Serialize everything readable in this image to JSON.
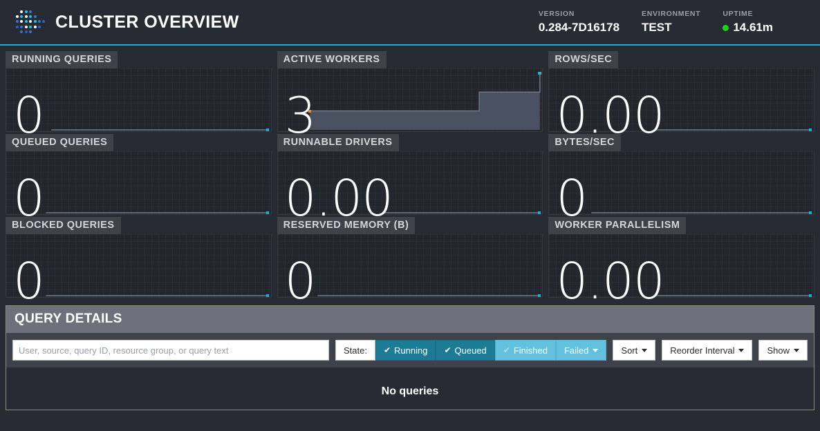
{
  "header": {
    "title": "CLUSTER OVERVIEW",
    "logo_icon": "trino-dots-logo-icon",
    "stats": [
      {
        "label": "VERSION",
        "value": "0.284-7D16178"
      },
      {
        "label": "ENVIRONMENT",
        "value": "TEST"
      },
      {
        "label": "UPTIME",
        "value": "14.61m",
        "dot_color": "#19d219"
      }
    ],
    "accent_color": "#19b0d6"
  },
  "stat_cards": [
    {
      "label": "RUNNING QUERIES",
      "value": "0",
      "chart_data": {
        "type": "area",
        "title": "Running Queries",
        "points": [
          0,
          0,
          0,
          0,
          0,
          0,
          0,
          0,
          0,
          0,
          0,
          0,
          0,
          0,
          0,
          0,
          0,
          0,
          0,
          0
        ],
        "ylim": [
          0,
          1
        ],
        "line_color": "#5c6775",
        "fill_color": "#4a5261",
        "endpoint_color": "#19b0d6",
        "grid": true,
        "spark_left_pct": 17,
        "has_start_marker": false
      }
    },
    {
      "label": "ACTIVE WORKERS",
      "value": "3",
      "chart_data": {
        "type": "area",
        "title": "Active Workers",
        "points": [
          1,
          1,
          1,
          1,
          1,
          1,
          1,
          1,
          1,
          1,
          1,
          1,
          1,
          1,
          2,
          2,
          2,
          2,
          2,
          3
        ],
        "ylim": [
          0,
          3
        ],
        "line_color": "#6b7481",
        "fill_color": "#49505f",
        "endpoint_color": "#19b0d6",
        "marker_color": "#f08a24",
        "grid": true,
        "spark_left_pct": 12,
        "has_start_marker": true
      }
    },
    {
      "label": "ROWS/SEC",
      "value": "0.00",
      "chart_data": {
        "type": "area",
        "title": "Rows per Second",
        "points": [
          0,
          0,
          0,
          0,
          0,
          0,
          0,
          0,
          0,
          0,
          0,
          0,
          0,
          0,
          0,
          0,
          0,
          0,
          0,
          0
        ],
        "ylim": [
          0,
          1
        ],
        "line_color": "#5c6775",
        "fill_color": "#4a5261",
        "endpoint_color": "#19b0d6",
        "grid": true,
        "spark_left_pct": 40,
        "has_start_marker": false
      }
    },
    {
      "label": "QUEUED QUERIES",
      "value": "0",
      "chart_data": {
        "type": "area",
        "title": "Queued Queries",
        "points": [
          0,
          0,
          0,
          0,
          0,
          0,
          0,
          0,
          0,
          0,
          0,
          0,
          0,
          0,
          0,
          0,
          0,
          0,
          0,
          0
        ],
        "ylim": [
          0,
          1
        ],
        "line_color": "#5c6775",
        "fill_color": "#4a5261",
        "endpoint_color": "#19b0d6",
        "grid": true,
        "spark_left_pct": 15,
        "has_start_marker": false
      }
    },
    {
      "label": "RUNNABLE DRIVERS",
      "value": "0.00",
      "chart_data": {
        "type": "area",
        "title": "Runnable Drivers",
        "points": [
          0,
          0,
          0,
          0,
          0,
          0,
          0,
          0,
          0,
          0,
          0,
          0,
          0,
          0,
          0,
          0,
          0,
          0,
          0,
          0
        ],
        "ylim": [
          0,
          1
        ],
        "line_color": "#5c6775",
        "fill_color": "#4a5261",
        "endpoint_color": "#19b0d6",
        "grid": true,
        "spark_left_pct": 40,
        "has_start_marker": false
      }
    },
    {
      "label": "BYTES/SEC",
      "value": "0",
      "chart_data": {
        "type": "area",
        "title": "Bytes per Second",
        "points": [
          0,
          0,
          0,
          0,
          0,
          0,
          0,
          0,
          0,
          0,
          0,
          0,
          0,
          0,
          0,
          0,
          0,
          0,
          0,
          0
        ],
        "ylim": [
          0,
          1
        ],
        "line_color": "#5c6775",
        "fill_color": "#4a5261",
        "endpoint_color": "#19b0d6",
        "grid": true,
        "spark_left_pct": 16,
        "has_start_marker": false
      }
    },
    {
      "label": "BLOCKED QUERIES",
      "value": "0",
      "chart_data": {
        "type": "area",
        "title": "Blocked Queries",
        "points": [
          0,
          0,
          0,
          0,
          0,
          0,
          0,
          0,
          0,
          0,
          0,
          0,
          0,
          0,
          0,
          0,
          0,
          0,
          0,
          0
        ],
        "ylim": [
          0,
          1
        ],
        "line_color": "#5c6775",
        "fill_color": "#4a5261",
        "endpoint_color": "#19b0d6",
        "grid": true,
        "spark_left_pct": 15,
        "has_start_marker": false
      }
    },
    {
      "label": "RESERVED MEMORY (B)",
      "value": "0",
      "chart_data": {
        "type": "area",
        "title": "Reserved Memory (B)",
        "points": [
          0,
          0,
          0,
          0,
          0,
          0,
          0,
          0,
          0,
          0,
          0,
          0,
          0,
          0,
          0,
          0,
          0,
          0,
          0,
          0
        ],
        "ylim": [
          0,
          1
        ],
        "line_color": "#5c6775",
        "fill_color": "#4a5261",
        "endpoint_color": "#19b0d6",
        "grid": true,
        "spark_left_pct": 15,
        "has_start_marker": false
      }
    },
    {
      "label": "WORKER PARALLELISM",
      "value": "0.00",
      "chart_data": {
        "type": "area",
        "title": "Worker Parallelism",
        "points": [
          0,
          0,
          0,
          0,
          0,
          0,
          0,
          0,
          0,
          0,
          0,
          0,
          0,
          0,
          0,
          0,
          0,
          0,
          0,
          0
        ],
        "ylim": [
          0,
          1
        ],
        "line_color": "#5c6775",
        "fill_color": "#4a5261",
        "endpoint_color": "#19b0d6",
        "grid": true,
        "spark_left_pct": 40,
        "has_start_marker": false
      }
    }
  ],
  "query_details": {
    "title": "QUERY DETAILS",
    "search_placeholder": "User, source, query ID, resource group, or query text",
    "search_value": "",
    "state_label": "State:",
    "state_buttons": [
      {
        "label": "Running",
        "checked": true,
        "active": true
      },
      {
        "label": "Queued",
        "checked": true,
        "active": true
      },
      {
        "label": "Finished",
        "checked": true,
        "active": false
      },
      {
        "label": "Failed",
        "checked": false,
        "active": false,
        "caret": true
      }
    ],
    "dropdowns": [
      {
        "label": "Sort"
      },
      {
        "label": "Reorder Interval"
      },
      {
        "label": "Show"
      }
    ],
    "empty_message": "No queries"
  }
}
